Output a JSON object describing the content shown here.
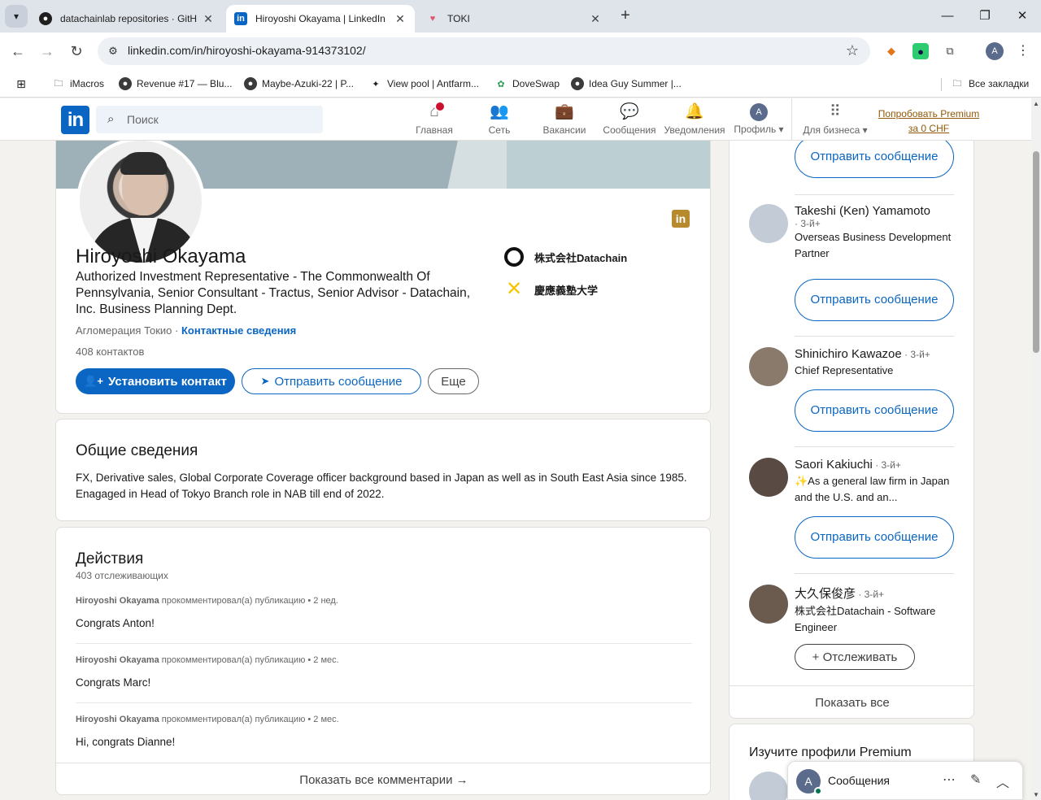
{
  "browser": {
    "tabs": [
      {
        "title": "datachainlab repositories · GitH",
        "icon": "github-icon"
      },
      {
        "title": "Hiroyoshi Okayama | LinkedIn",
        "icon": "linkedin-icon"
      },
      {
        "title": "TOKI",
        "icon": "toki-icon"
      }
    ],
    "url": "linkedin.com/in/hiroyoshi-okayama-914373102/",
    "bookmarks": [
      {
        "label": "iMacros"
      },
      {
        "label": "Revenue #17 — Blu..."
      },
      {
        "label": "Maybe-Azuki-22 | P..."
      },
      {
        "label": "View pool | Antfarm..."
      },
      {
        "label": "DoveSwap"
      },
      {
        "label": "Idea Guy Summer |..."
      }
    ],
    "all_bookmarks": "Все закладки",
    "profile_initial": "A"
  },
  "linkedin_nav": {
    "logo": "in",
    "search_placeholder": "Поиск",
    "items": [
      {
        "label": "Главная"
      },
      {
        "label": "Сеть"
      },
      {
        "label": "Вакансии"
      },
      {
        "label": "Сообщения"
      },
      {
        "label": "Уведомления"
      },
      {
        "label": "Профиль ▾"
      },
      {
        "label": "Для бизнеса ▾"
      }
    ],
    "avatar_initial": "A",
    "premium_line1": "Попробовать Premium",
    "premium_line2": "за 0 CHF"
  },
  "profile": {
    "name": "Hiroyoshi Okayama",
    "headline": "Authorized Investment Representative - The Commonwealth Of Pennsylvania, Senior Consultant - Tractus, Senior Advisor - Datachain, Inc. Business Planning Dept.",
    "location": "Агломерация Токио · ",
    "contact_info": "Контактные сведения",
    "connections": "408 контактов",
    "connect_label": "Установить контакт",
    "message_label": "Отправить сообщение",
    "more_label": "Еще",
    "orgs": [
      {
        "name": "株式会社Datachain"
      },
      {
        "name": "慶應義塾大学"
      }
    ],
    "badge": "in"
  },
  "about": {
    "title": "Общие сведения",
    "text": "FX, Derivative sales, Global Corporate Coverage officer background based in Japan as well as in South East Asia since 1985. Enagaged in Head of Tokyo Branch role in NAB till end of 2022."
  },
  "activity": {
    "title": "Действия",
    "followers": "403 отслеживающих",
    "items": [
      {
        "author": "Hiroyoshi Okayama",
        "action": " прокомментировал(а) публикацию • 2 нед.",
        "text": "Congrats Anton!"
      },
      {
        "author": "Hiroyoshi Okayama",
        "action": " прокомментировал(а) публикацию • 2 мес.",
        "text": "Congrats Marc!"
      },
      {
        "author": "Hiroyoshi Okayama",
        "action": " прокомментировал(а) публикацию • 2 мес.",
        "text": "Hi, congrats Dianne!"
      }
    ],
    "show_all": "Показать все комментарии →"
  },
  "rail": {
    "top_message_btn": "Отправить сообщение",
    "people": [
      {
        "name": "Takeshi (Ken) Yamamoto",
        "degree": "· 3-й+",
        "title": "Overseas Business Development Partner",
        "button": "Отправить сообщение"
      },
      {
        "name": "Shinichiro Kawazoe",
        "degree": " · 3-й+",
        "title": "Chief Representative",
        "button": "Отправить сообщение"
      },
      {
        "name": "Saori Kakiuchi",
        "degree": " · 3-й+",
        "title": "✨As a general law firm in Japan and the U.S. and an...",
        "button": "Отправить сообщение"
      },
      {
        "name": "大久保俊彦",
        "degree": " · 3-й+",
        "title": "株式会社Datachain - Software Engineer",
        "button": "+ Отслеживать"
      }
    ],
    "show_all": "Показать все",
    "premium_title": "Изучите профили Premium"
  },
  "messaging": {
    "title": "Сообщения",
    "avatar_initial": "A"
  },
  "colors": {
    "linkedin_blue": "#0a66c2",
    "premium_gold": "#915907",
    "notification_red": "#cb112d"
  }
}
